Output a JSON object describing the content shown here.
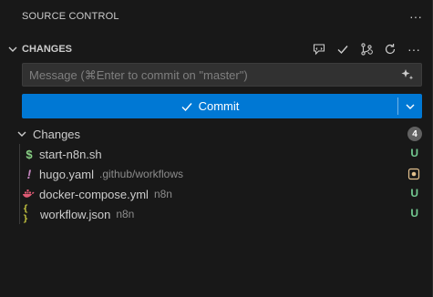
{
  "panel": {
    "title": "SOURCE CONTROL",
    "more_glyph": "···"
  },
  "section": {
    "title": "CHANGES",
    "actions": [
      "copilot-chat-icon",
      "check-icon",
      "branch-refresh-icon",
      "refresh-icon",
      "more-icon"
    ],
    "more_glyph": "···"
  },
  "message": {
    "placeholder": "Message (⌘Enter to commit on \"master\")",
    "value": ""
  },
  "commit": {
    "label": "Commit",
    "color": "#0078d4"
  },
  "group": {
    "label": "Changes",
    "count": "4"
  },
  "files": [
    {
      "name": "start-n8n.sh",
      "dir": "",
      "icon": "$",
      "icon_color": "#89d185",
      "status": "U"
    },
    {
      "name": "hugo.yaml",
      "dir": ".github/workflows",
      "icon": "!",
      "icon_color": "#c586c0",
      "status": "M"
    },
    {
      "name": "docker-compose.yml",
      "dir": "n8n",
      "icon": "whale",
      "icon_color": "#e05a74",
      "status": "U"
    },
    {
      "name": "workflow.json",
      "dir": "n8n",
      "icon": "{ }",
      "icon_color": "#cbcb41",
      "status": "U"
    }
  ],
  "colors": {
    "untracked": "#73c991",
    "modified": "#e2c08d",
    "background": "#181818"
  }
}
